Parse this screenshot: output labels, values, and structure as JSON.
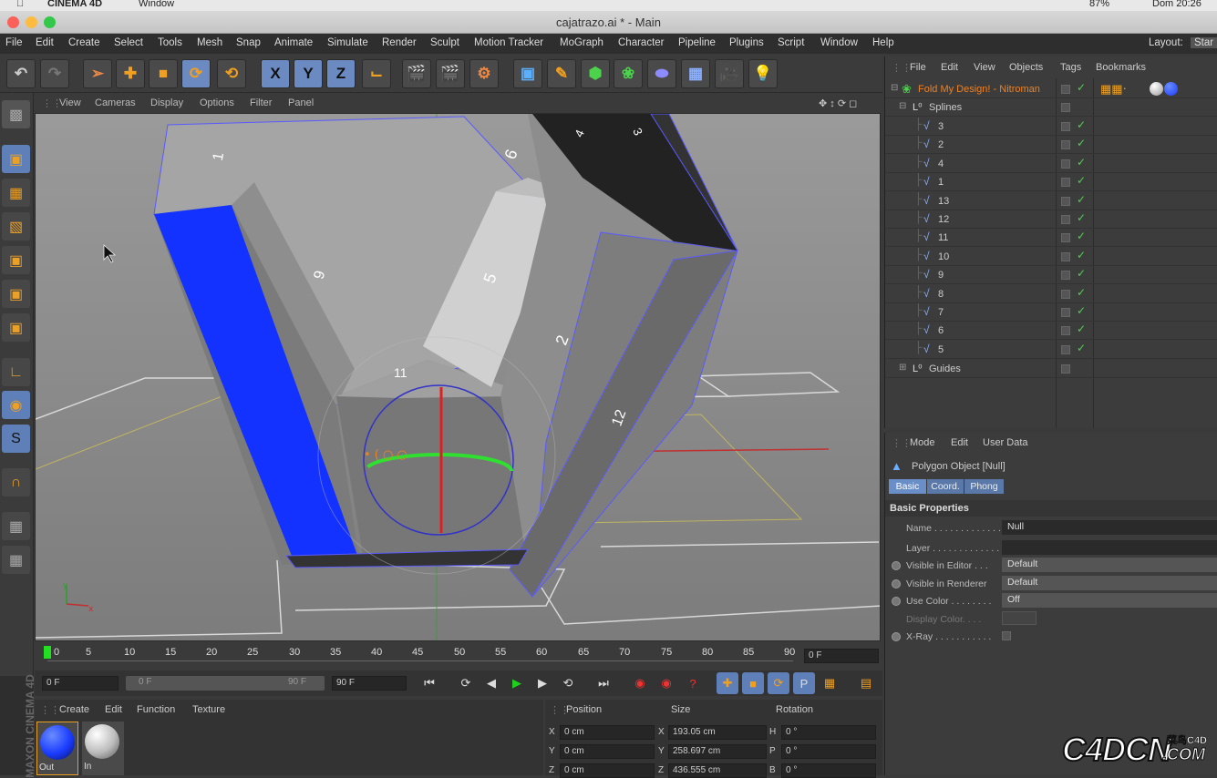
{
  "mac_menu": {
    "app": "CINEMA 4D",
    "window": "Window",
    "battery": "87%",
    "clock": "Dom 20:26"
  },
  "window_title": "cajatrazo.ai * - Main",
  "menu": [
    "File",
    "Edit",
    "Create",
    "Select",
    "Tools",
    "Mesh",
    "Snap",
    "Animate",
    "Simulate",
    "Render",
    "Sculpt",
    "Motion Tracker",
    "MoGraph",
    "Character",
    "Pipeline",
    "Plugins",
    "Script",
    "Window",
    "Help"
  ],
  "layout": {
    "label": "Layout:",
    "value": "Star"
  },
  "viewport_menu": [
    "View",
    "Cameras",
    "Display",
    "Options",
    "Filter",
    "Panel"
  ],
  "axis_buttons": [
    "X",
    "Y",
    "Z"
  ],
  "timeline": {
    "ticks": [
      "0",
      "5",
      "10",
      "15",
      "20",
      "25",
      "30",
      "35",
      "40",
      "45",
      "50",
      "55",
      "60",
      "65",
      "70",
      "75",
      "80",
      "85",
      "90"
    ],
    "current": "0 F"
  },
  "transport": {
    "start": "0 F",
    "range_start": "0 F",
    "range_end": "90 F",
    "end": "90 F"
  },
  "material_menu": [
    "Create",
    "Edit",
    "Function",
    "Texture"
  ],
  "materials": [
    {
      "name": "Out",
      "color": "#1a3cff"
    },
    {
      "name": "In",
      "color": "#bbbbbb"
    }
  ],
  "coords": {
    "headers": [
      "Position",
      "Size",
      "Rotation"
    ],
    "rows": [
      {
        "axis": "X",
        "pos": "0 cm",
        "size_axis": "X",
        "size": "193.05 cm",
        "rot_axis": "H",
        "rot": "0 °"
      },
      {
        "axis": "Y",
        "pos": "0 cm",
        "size_axis": "Y",
        "size": "258.697 cm",
        "rot_axis": "P",
        "rot": "0 °"
      },
      {
        "axis": "Z",
        "pos": "0 cm",
        "size_axis": "Z",
        "size": "436.555 cm",
        "rot_axis": "B",
        "rot": "0 °"
      }
    ]
  },
  "maxon_text": "MAXON CINEMA 4D",
  "object_manager": {
    "menu": [
      "File",
      "Edit",
      "View",
      "Objects",
      "Tags",
      "Bookmarks"
    ],
    "root": "Fold My Design! - Nitroman",
    "splines_group": "Splines",
    "splines": [
      "3",
      "2",
      "4",
      "1",
      "13",
      "12",
      "11",
      "10",
      "9",
      "8",
      "7",
      "6",
      "5"
    ],
    "guides": "Guides"
  },
  "attribute_manager": {
    "menu": [
      "Mode",
      "Edit",
      "User Data"
    ],
    "object": "Polygon Object [Null]",
    "tabs": [
      "Basic",
      "Coord.",
      "Phong"
    ],
    "section": "Basic Properties",
    "fields": [
      {
        "label": "Name . . . . . . . . . . . . .",
        "value": "Null"
      },
      {
        "label": "Layer . . . . . . . . . . . . .",
        "value": ""
      },
      {
        "label": "Visible in Editor . . .",
        "value": "Default"
      },
      {
        "label": "Visible in Renderer",
        "value": "Default"
      },
      {
        "label": "Use Color . . . . . . . .",
        "value": "Off"
      },
      {
        "label": "Display Color. . . .",
        "value": ""
      },
      {
        "label": "X-Ray . . . . . . . . . . .",
        "value": ""
      }
    ]
  },
  "viewport_labels": [
    "1",
    "9",
    "6",
    "4",
    "5",
    "2",
    "11",
    "12",
    "3"
  ],
  "watermark": {
    "main": "C4DCN",
    "sub": "菜鸟C4D",
    "domain": ".COM"
  }
}
